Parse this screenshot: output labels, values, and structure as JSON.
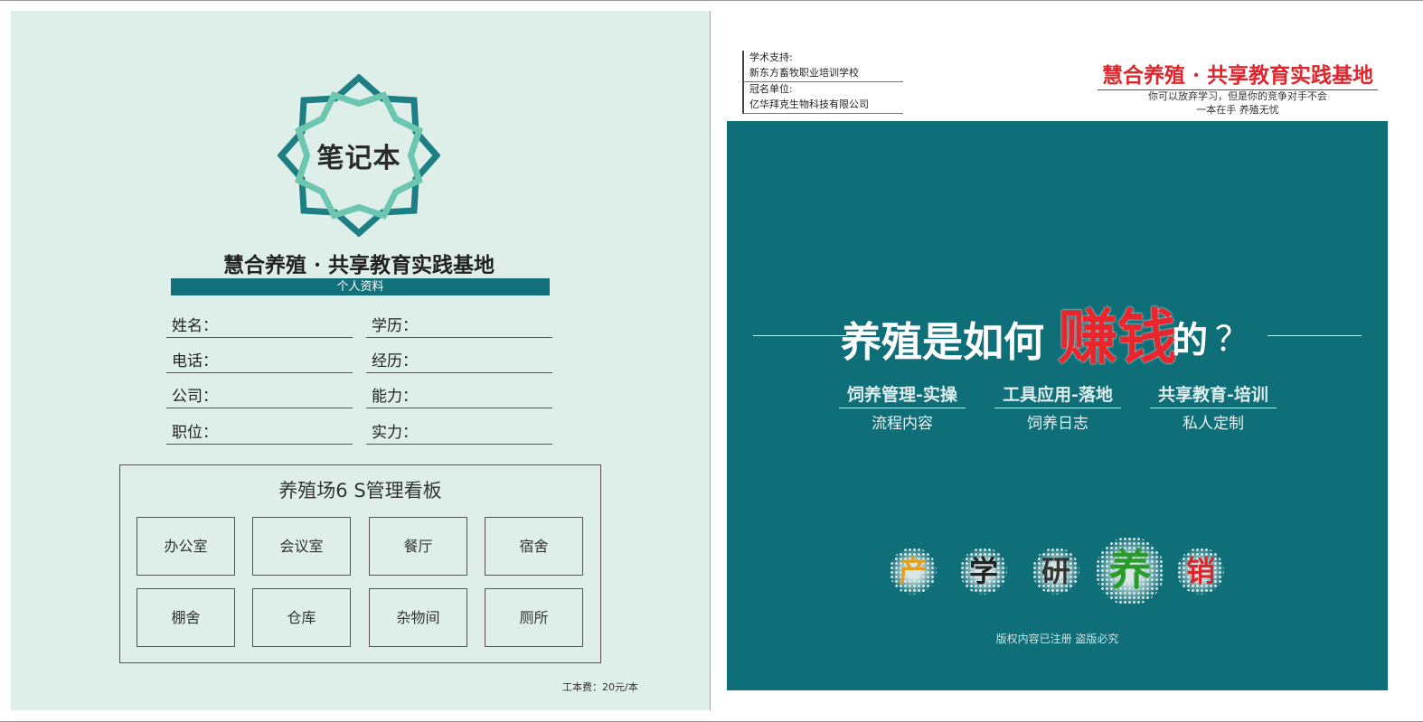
{
  "left": {
    "emblem_text": "笔记本",
    "title": "慧合养殖 · 共享教育实践基地",
    "section_bar": "个人资料",
    "fields": [
      "姓名：",
      "学历：",
      "电话：",
      "经历：",
      "公司：",
      "能力：",
      "职位：",
      "实力："
    ],
    "board": {
      "title": "养殖场6 S管理看板",
      "cells": [
        "办公室",
        "会议室",
        "餐厅",
        "宿舍",
        "棚舍",
        "仓库",
        "杂物间",
        "厕所"
      ]
    },
    "fee": "工本费：20元/本"
  },
  "right": {
    "sponsor": {
      "academic_label": "学术支持:",
      "academic_value": "新东方畜牧职业培训学校",
      "naming_label": "冠名单位:",
      "naming_value": "亿华拜克生物科技有限公司"
    },
    "brand": {
      "title": "慧合养殖 · 共享教育实践基地",
      "subtitle_1": "你可以放弃学习，但是你的竞争对手不会",
      "subtitle_2": "一本在手   养殖无忧"
    },
    "headline": {
      "part1": "养殖是如何",
      "part2": "赚钱",
      "part3": "的",
      "mark": "？"
    },
    "pillars": [
      {
        "title": "饲养管理-实操",
        "sub": "流程内容"
      },
      {
        "title": "工具应用-落地",
        "sub": "饲养日志"
      },
      {
        "title": "共享教育-培训",
        "sub": "私人定制"
      }
    ],
    "circles": [
      {
        "char": "产",
        "color": "#e0a020"
      },
      {
        "char": "学",
        "color": "#222222"
      },
      {
        "char": "研",
        "color": "#333333"
      },
      {
        "char": "养",
        "color": "#2a9a2a"
      },
      {
        "char": "销",
        "color": "#d8262c"
      }
    ],
    "copyright": "版权内容已注册 盗版必究"
  },
  "colors": {
    "teal": "#0f6f78",
    "left_bg": "#deefe9",
    "accent_red": "#e0262c"
  }
}
